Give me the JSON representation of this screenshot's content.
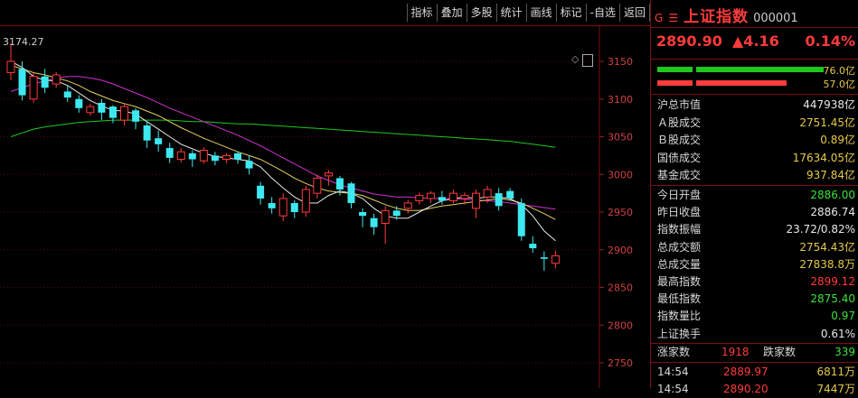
{
  "toolbar": {
    "buttons": [
      "指标",
      "叠加",
      "多股",
      "统计",
      "画线",
      "标记",
      "-自选",
      "返回"
    ]
  },
  "chart": {
    "high_label": "3174.27",
    "y_ticks": [
      "3150",
      "3100",
      "3050",
      "3000",
      "2950",
      "2900",
      "2850",
      "2800",
      "2750"
    ],
    "candles": [
      {
        "o": 3135,
        "c": 3150,
        "h": 3174,
        "l": 3125
      },
      {
        "o": 3140,
        "c": 3105,
        "h": 3150,
        "l": 3098
      },
      {
        "o": 3100,
        "c": 3130,
        "h": 3135,
        "l": 3095
      },
      {
        "o": 3130,
        "c": 3115,
        "h": 3140,
        "l": 3108
      },
      {
        "o": 3120,
        "c": 3132,
        "h": 3136,
        "l": 3115
      },
      {
        "o": 3110,
        "c": 3102,
        "h": 3118,
        "l": 3096
      },
      {
        "o": 3100,
        "c": 3088,
        "h": 3105,
        "l": 3082
      },
      {
        "o": 3082,
        "c": 3090,
        "h": 3094,
        "l": 3078
      },
      {
        "o": 3095,
        "c": 3082,
        "h": 3100,
        "l": 3072
      },
      {
        "o": 3090,
        "c": 3075,
        "h": 3092,
        "l": 3068
      },
      {
        "o": 3072,
        "c": 3090,
        "h": 3094,
        "l": 3065
      },
      {
        "o": 3085,
        "c": 3070,
        "h": 3088,
        "l": 3060
      },
      {
        "o": 3065,
        "c": 3045,
        "h": 3070,
        "l": 3035
      },
      {
        "o": 3048,
        "c": 3040,
        "h": 3058,
        "l": 3030
      },
      {
        "o": 3035,
        "c": 3022,
        "h": 3042,
        "l": 3015
      },
      {
        "o": 3020,
        "c": 3030,
        "h": 3035,
        "l": 3016
      },
      {
        "o": 3028,
        "c": 3020,
        "h": 3032,
        "l": 3010
      },
      {
        "o": 3018,
        "c": 3032,
        "h": 3036,
        "l": 3014
      },
      {
        "o": 3025,
        "c": 3018,
        "h": 3030,
        "l": 3012
      },
      {
        "o": 3020,
        "c": 3025,
        "h": 3028,
        "l": 3015
      },
      {
        "o": 3028,
        "c": 3020,
        "h": 3030,
        "l": 3014
      },
      {
        "o": 3018,
        "c": 3008,
        "h": 3025,
        "l": 3000
      },
      {
        "o": 2985,
        "c": 2968,
        "h": 2990,
        "l": 2960
      },
      {
        "o": 2962,
        "c": 2955,
        "h": 2970,
        "l": 2948
      },
      {
        "o": 2945,
        "c": 2968,
        "h": 2975,
        "l": 2938
      },
      {
        "o": 2962,
        "c": 2950,
        "h": 2966,
        "l": 2942
      },
      {
        "o": 2950,
        "c": 2980,
        "h": 2985,
        "l": 2944
      },
      {
        "o": 2975,
        "c": 2995,
        "h": 3000,
        "l": 2968
      },
      {
        "o": 2998,
        "c": 3002,
        "h": 3006,
        "l": 2985
      },
      {
        "o": 2995,
        "c": 2980,
        "h": 2998,
        "l": 2972
      },
      {
        "o": 2988,
        "c": 2962,
        "h": 2990,
        "l": 2955
      },
      {
        "o": 2950,
        "c": 2945,
        "h": 2955,
        "l": 2930
      },
      {
        "o": 2942,
        "c": 2930,
        "h": 2948,
        "l": 2920
      },
      {
        "o": 2935,
        "c": 2952,
        "h": 2958,
        "l": 2908
      },
      {
        "o": 2952,
        "c": 2945,
        "h": 2958,
        "l": 2940
      },
      {
        "o": 2955,
        "c": 2962,
        "h": 2966,
        "l": 2948
      },
      {
        "o": 2965,
        "c": 2972,
        "h": 2976,
        "l": 2960
      },
      {
        "o": 2968,
        "c": 2975,
        "h": 2978,
        "l": 2962
      },
      {
        "o": 2970,
        "c": 2965,
        "h": 2978,
        "l": 2960
      },
      {
        "o": 2965,
        "c": 2975,
        "h": 2980,
        "l": 2962
      },
      {
        "o": 2968,
        "c": 2972,
        "h": 2976,
        "l": 2960
      },
      {
        "o": 2955,
        "c": 2975,
        "h": 2980,
        "l": 2942
      },
      {
        "o": 2970,
        "c": 2980,
        "h": 2985,
        "l": 2962
      },
      {
        "o": 2975,
        "c": 2958,
        "h": 2982,
        "l": 2952
      },
      {
        "o": 2978,
        "c": 2968,
        "h": 2982,
        "l": 2965
      },
      {
        "o": 2962,
        "c": 2918,
        "h": 2968,
        "l": 2912
      },
      {
        "o": 2908,
        "c": 2902,
        "h": 2918,
        "l": 2896
      },
      {
        "o": 2890,
        "c": 2888,
        "h": 2898,
        "l": 2872
      },
      {
        "o": 2882,
        "c": 2892,
        "h": 2899,
        "l": 2875
      }
    ],
    "ma5": [
      3150,
      3142,
      3130,
      3125,
      3124,
      3118,
      3108,
      3098,
      3091,
      3085,
      3084,
      3080,
      3070,
      3060,
      3050,
      3040,
      3034,
      3028,
      3024,
      3022,
      3020,
      3018,
      3010,
      2995,
      2982,
      2970,
      2962,
      2962,
      2972,
      2978,
      2975,
      2968,
      2955,
      2945,
      2942,
      2942,
      2950,
      2958,
      2965,
      2968,
      2970,
      2968,
      2970,
      2970,
      2968,
      2960,
      2945,
      2925,
      2912
    ],
    "ma10": [
      3145,
      3140,
      3135,
      3132,
      3128,
      3124,
      3118,
      3110,
      3104,
      3098,
      3094,
      3090,
      3084,
      3078,
      3070,
      3062,
      3055,
      3048,
      3042,
      3036,
      3030,
      3025,
      3020,
      3012,
      3004,
      2995,
      2988,
      2982,
      2978,
      2976,
      2975,
      2972,
      2966,
      2960,
      2955,
      2952,
      2952,
      2955,
      2958,
      2960,
      2962,
      2964,
      2966,
      2968,
      2966,
      2962,
      2955,
      2948,
      2940
    ],
    "ma20": [
      3110,
      3115,
      3120,
      3124,
      3128,
      3130,
      3130,
      3128,
      3125,
      3120,
      3114,
      3108,
      3102,
      3095,
      3088,
      3082,
      3076,
      3070,
      3064,
      3058,
      3052,
      3045,
      3038,
      3030,
      3022,
      3014,
      3006,
      2998,
      2992,
      2986,
      2982,
      2978,
      2974,
      2972,
      2970,
      2970,
      2969,
      2968,
      2968,
      2968,
      2967,
      2966,
      2965,
      2964,
      2962,
      2960,
      2958,
      2956,
      2954
    ],
    "ma60": [
      3050,
      3055,
      3060,
      3063,
      3065,
      3067,
      3069,
      3070,
      3071,
      3072,
      3072,
      3072,
      3072,
      3072,
      3072,
      3071,
      3070,
      3070,
      3069,
      3068,
      3067,
      3067,
      3066,
      3065,
      3064,
      3063,
      3062,
      3061,
      3060,
      3059,
      3058,
      3057,
      3056,
      3055,
      3054,
      3053,
      3052,
      3051,
      3050,
      3049,
      3048,
      3047,
      3046,
      3045,
      3044,
      3042,
      3040,
      3038,
      3036
    ]
  },
  "panel": {
    "ticker": {
      "prefix": "G",
      "menu": "☰",
      "name": "上证指数",
      "code": "000001"
    },
    "quote": {
      "price": "2890.90",
      "change": "▲4.16",
      "percent": "0.14%"
    },
    "bars": [
      {
        "label": "76.0亿",
        "color": "#1ec81e",
        "segments": [
          0.18,
          0.62
        ]
      },
      {
        "label": "57.0亿",
        "color": "#ff3b3b",
        "segments": [
          0.18,
          0.44
        ]
      }
    ],
    "rows1": [
      {
        "label": "沪总市值",
        "value": "447938亿",
        "cls": "white"
      },
      {
        "label": "Ａ股成交",
        "value": "2751.45亿",
        "cls": "yellow"
      },
      {
        "label": "Ｂ股成交",
        "value": "0.89亿",
        "cls": "yellow"
      },
      {
        "label": "国债成交",
        "value": "17634.05亿",
        "cls": "yellow"
      },
      {
        "label": "基金成交",
        "value": "937.84亿",
        "cls": "yellow"
      }
    ],
    "rows2": [
      {
        "label": "今日开盘",
        "value": "2886.00",
        "cls": "green"
      },
      {
        "label": "昨日收盘",
        "value": "2886.74",
        "cls": "white"
      },
      {
        "label": "指数振幅",
        "value": "23.72/0.82%",
        "cls": "white"
      },
      {
        "label": "总成交额",
        "value": "2754.43亿",
        "cls": "yellow"
      },
      {
        "label": "总成交量",
        "value": "27838.8万",
        "cls": "yellow"
      },
      {
        "label": "最高指数",
        "value": "2899.12",
        "cls": "red"
      },
      {
        "label": "最低指数",
        "value": "2875.40",
        "cls": "green"
      },
      {
        "label": "指数量比",
        "value": "0.97",
        "cls": "green"
      },
      {
        "label": "上证换手",
        "value": "0.61%",
        "cls": "white"
      }
    ],
    "updown": {
      "up_label": "涨家数",
      "up": "1918",
      "down_label": "跌家数",
      "down": "339"
    },
    "ticks": [
      {
        "time": "14:54",
        "price": "2889.97",
        "vol": "6811万"
      },
      {
        "time": "14:54",
        "price": "2890.20",
        "vol": "7447万"
      }
    ]
  }
}
